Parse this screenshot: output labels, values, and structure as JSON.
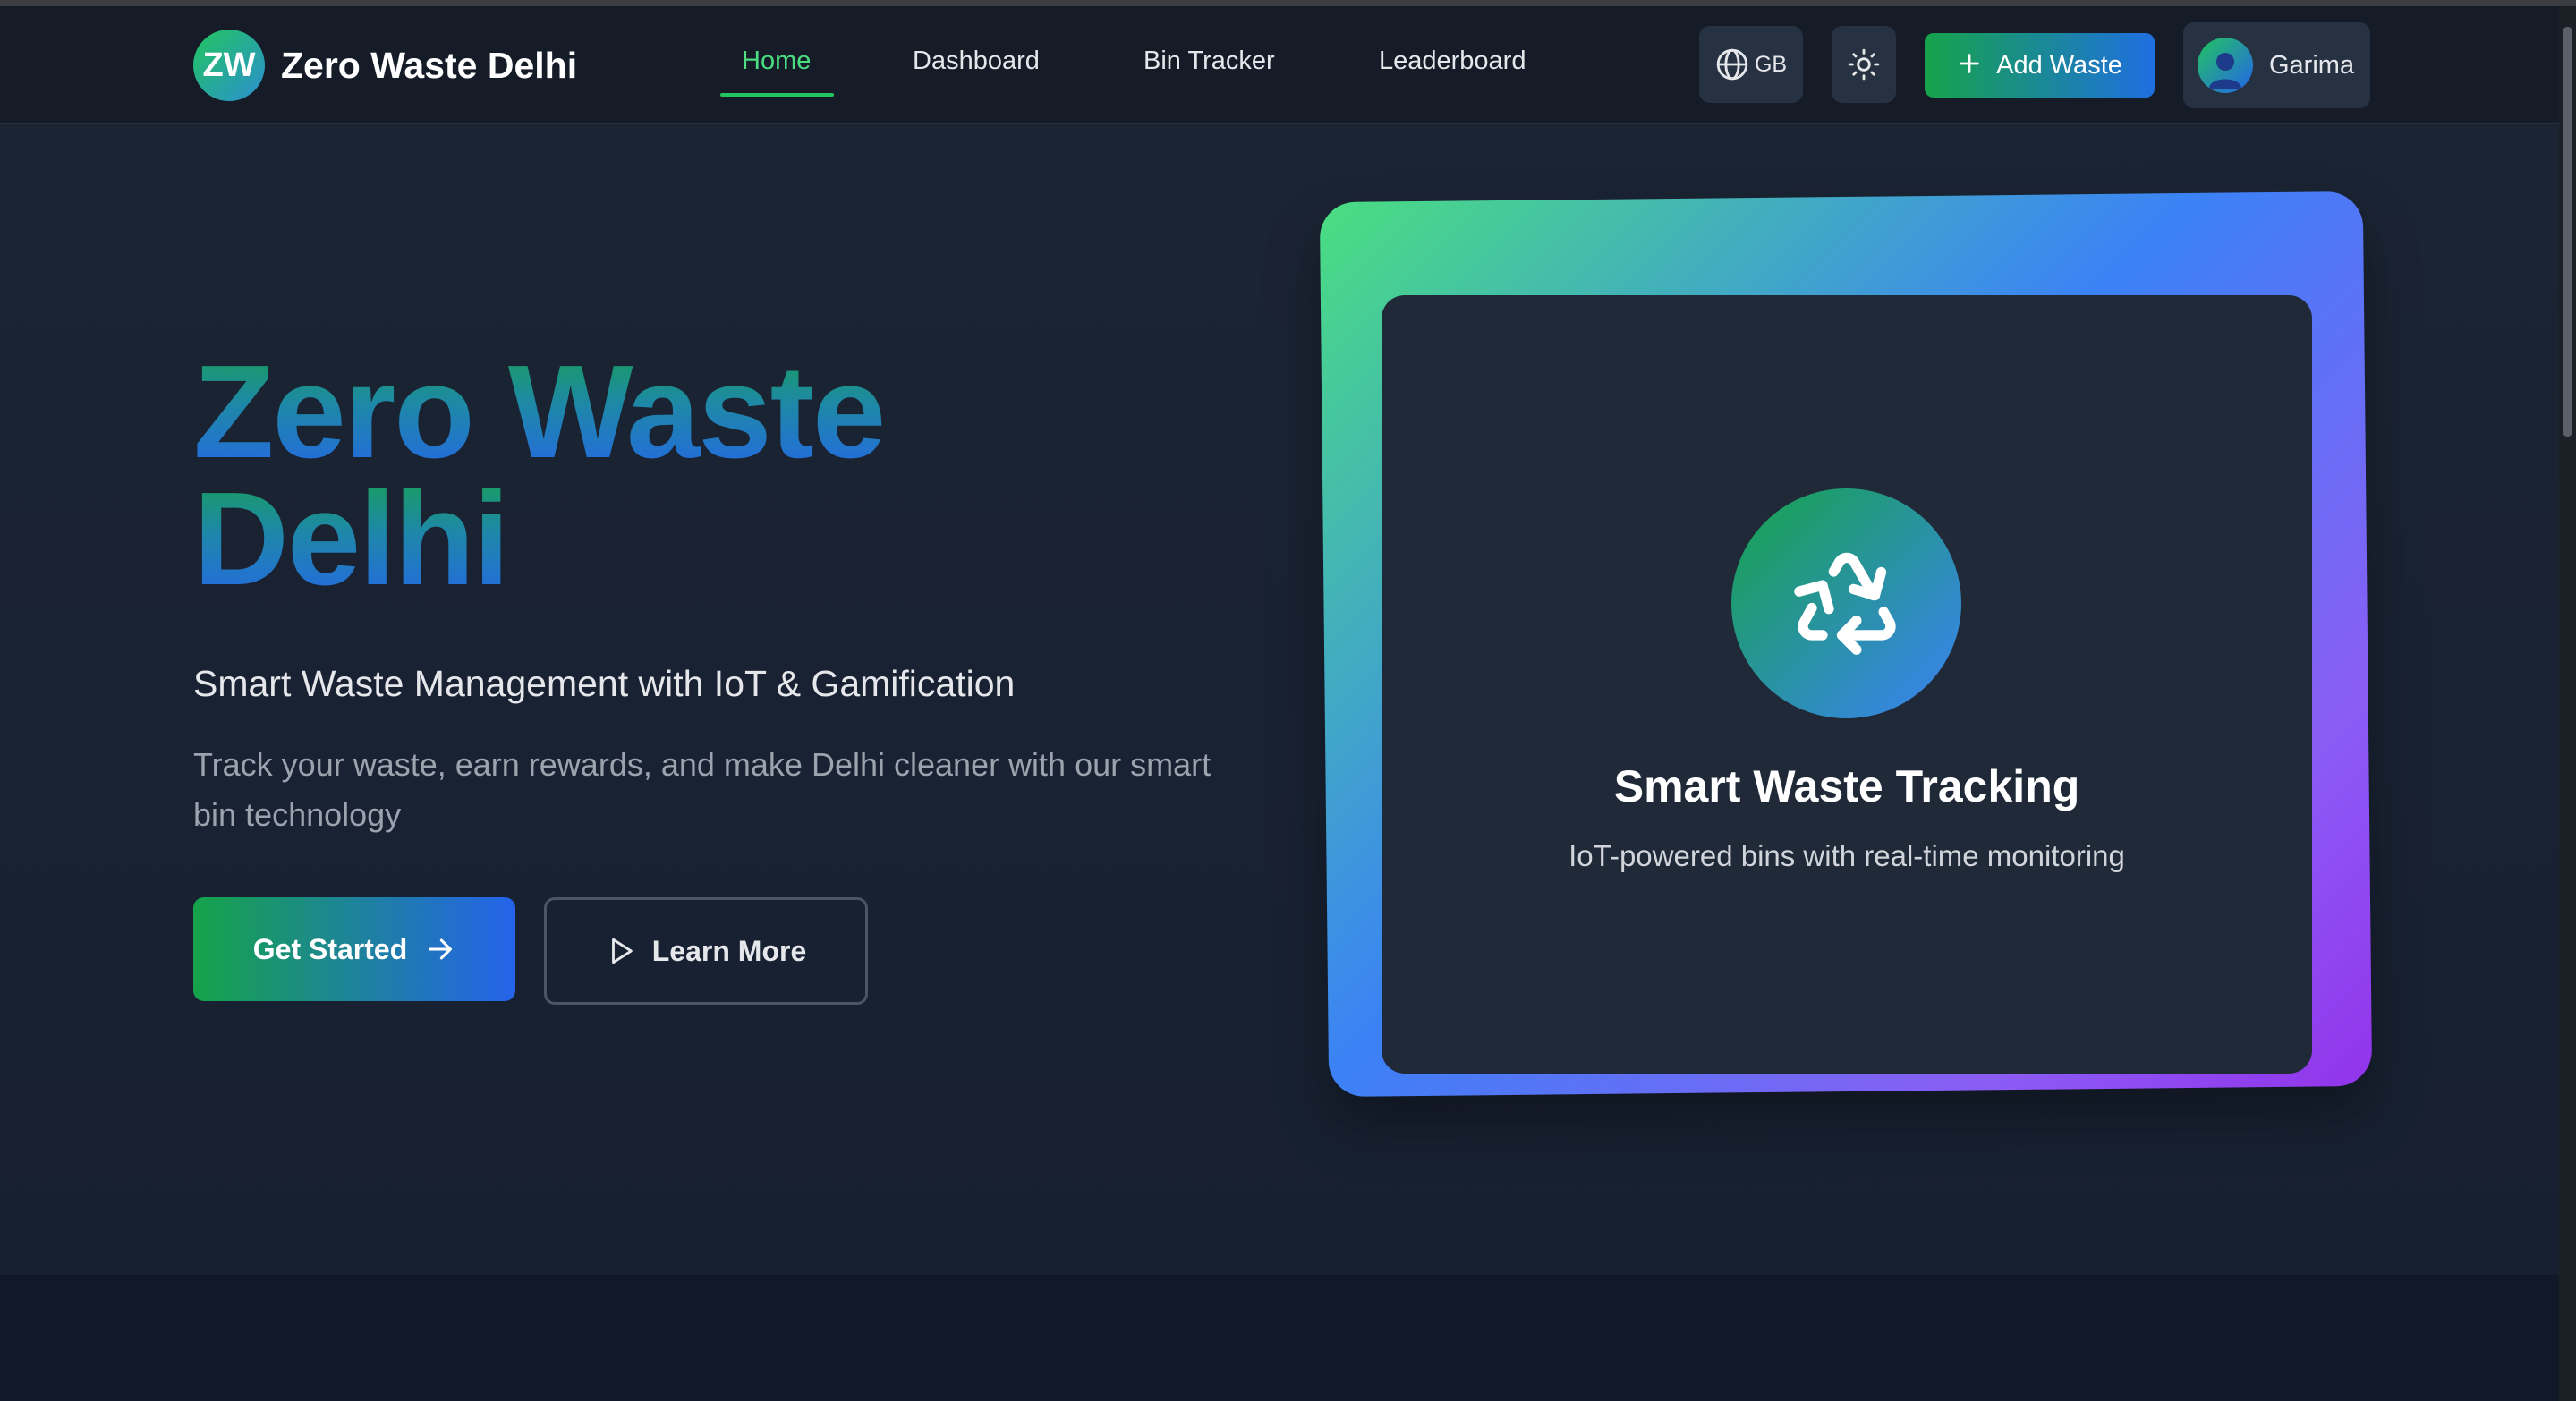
{
  "header": {
    "logo_initials": "ZW",
    "app_title": "Zero Waste Delhi",
    "nav": [
      {
        "label": "Home",
        "active": true
      },
      {
        "label": "Dashboard",
        "active": false
      },
      {
        "label": "Bin Tracker",
        "active": false
      },
      {
        "label": "Leaderboard",
        "active": false
      }
    ],
    "language_code": "GB",
    "add_waste_label": "Add Waste",
    "user_name": "Garima"
  },
  "hero": {
    "title_line1": "Zero Waste",
    "title_line2": "Delhi",
    "subtitle": "Smart Waste Management with IoT & Gamification",
    "description": "Track your waste, earn rewards, and make Delhi cleaner with our smart bin technology",
    "primary_button": "Get Started",
    "secondary_button": "Learn More"
  },
  "feature_card": {
    "title": "Smart Waste Tracking",
    "description": "IoT-powered bins with real-time monitoring"
  },
  "icons": [
    "globe-icon",
    "sun-icon",
    "plus-icon",
    "user-icon",
    "arrow-right-icon",
    "play-icon",
    "recycle-icon"
  ],
  "colors": {
    "accent_green": "#22c55e",
    "accent_blue": "#2563eb",
    "accent_purple": "#9333ea",
    "background": "#111827",
    "navbar": "#151c28"
  }
}
